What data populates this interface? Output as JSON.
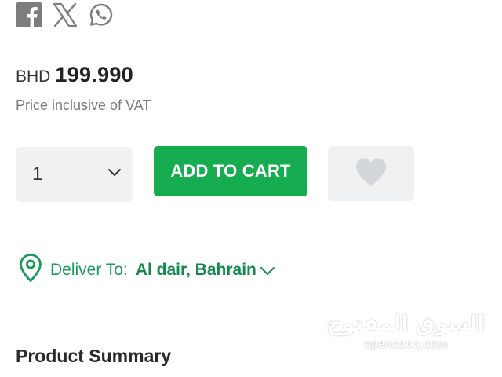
{
  "share": {
    "icons": [
      "facebook-icon",
      "x-twitter-icon",
      "whatsapp-icon"
    ]
  },
  "price": {
    "currency": "BHD",
    "amount": "199.990",
    "vat_note": "Price inclusive of VAT"
  },
  "quantity": {
    "selected": "1"
  },
  "actions": {
    "add_to_cart_label": "ADD TO CART",
    "wishlist_icon": "heart-icon"
  },
  "delivery": {
    "label": "Deliver To:",
    "location": "Al dair, Bahrain"
  },
  "sections": {
    "product_summary": "Product Summary"
  },
  "watermark": {
    "arabic": "السوق المفتوح",
    "latin": "opensooq.com"
  },
  "colors": {
    "accent_green": "#16ac50",
    "deliver_green": "#138a4b",
    "icon_gray": "#7d7d7d",
    "button_gray": "#f0f1f2"
  }
}
